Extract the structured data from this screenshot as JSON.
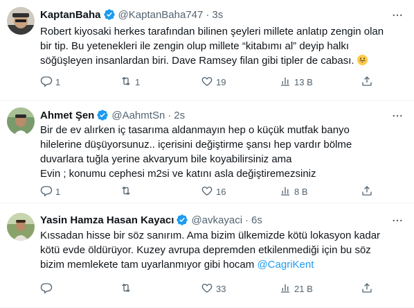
{
  "tweets": [
    {
      "name": "KaptanBaha",
      "handle": "@KaptanBaha747",
      "time": "3s",
      "lines": [
        "Robert kiyosaki herkes tarafından bilinen şeyleri millete anlatıp zengin olan",
        "bir tip. Bu yetenekleri ile zengin olup millete “kitabımı al” deyip halkı",
        "söğüşleyen insanlardan biri. Dave Ramsey filan gibi tipler de cabası."
      ],
      "replies": "1",
      "retweets": "1",
      "likes": "19",
      "views": "13 B"
    },
    {
      "name": "Ahmet Şen",
      "handle": "@AahmtSn",
      "time": "2s",
      "lines": [
        "Bir de ev alırken iç tasarıma aldanmayın hep o küçük mutfak banyo",
        "hilelerine düşüyorsunuz.. içerisini değiştirme şansı hep vardır bölme",
        "duvarlara tuğla yerine akvaryum bile koyabilirsiniz ama",
        "Evin ; konumu cephesi m2si ve katını asla değiştiremezsiniz"
      ],
      "replies": "1",
      "retweets": "",
      "likes": "16",
      "views": "8 B"
    },
    {
      "name": "Yasin Hamza Hasan Kayacı",
      "handle": "@avkayaci",
      "time": "6s",
      "lines": [
        "Kıssadan hisse bir söz sanırım. Ama bizim ülkemizde kötü lokasyon kadar",
        "kötü evde öldürüyor. Kuzey avrupa depremden etkilenmediği için bu söz",
        "bizim memlekete tam uyarlanmıyor gibi hocam"
      ],
      "mention": "@CagriKent",
      "replies": "",
      "retweets": "",
      "likes": "33",
      "views": "21 B"
    }
  ],
  "colors": {
    "verified": "#1d9bf0",
    "muted": "#536471",
    "text": "#0f1419",
    "mention": "#1d9bf0"
  },
  "icons": {
    "verified": "verified-badge-icon",
    "more": "more-horizontal-icon",
    "reply": "reply-bubble-icon",
    "retweet": "retweet-icon",
    "like": "heart-icon",
    "views": "views-bar-chart-icon",
    "share": "share-upload-icon",
    "emoji": "grinning-face-emoji"
  }
}
